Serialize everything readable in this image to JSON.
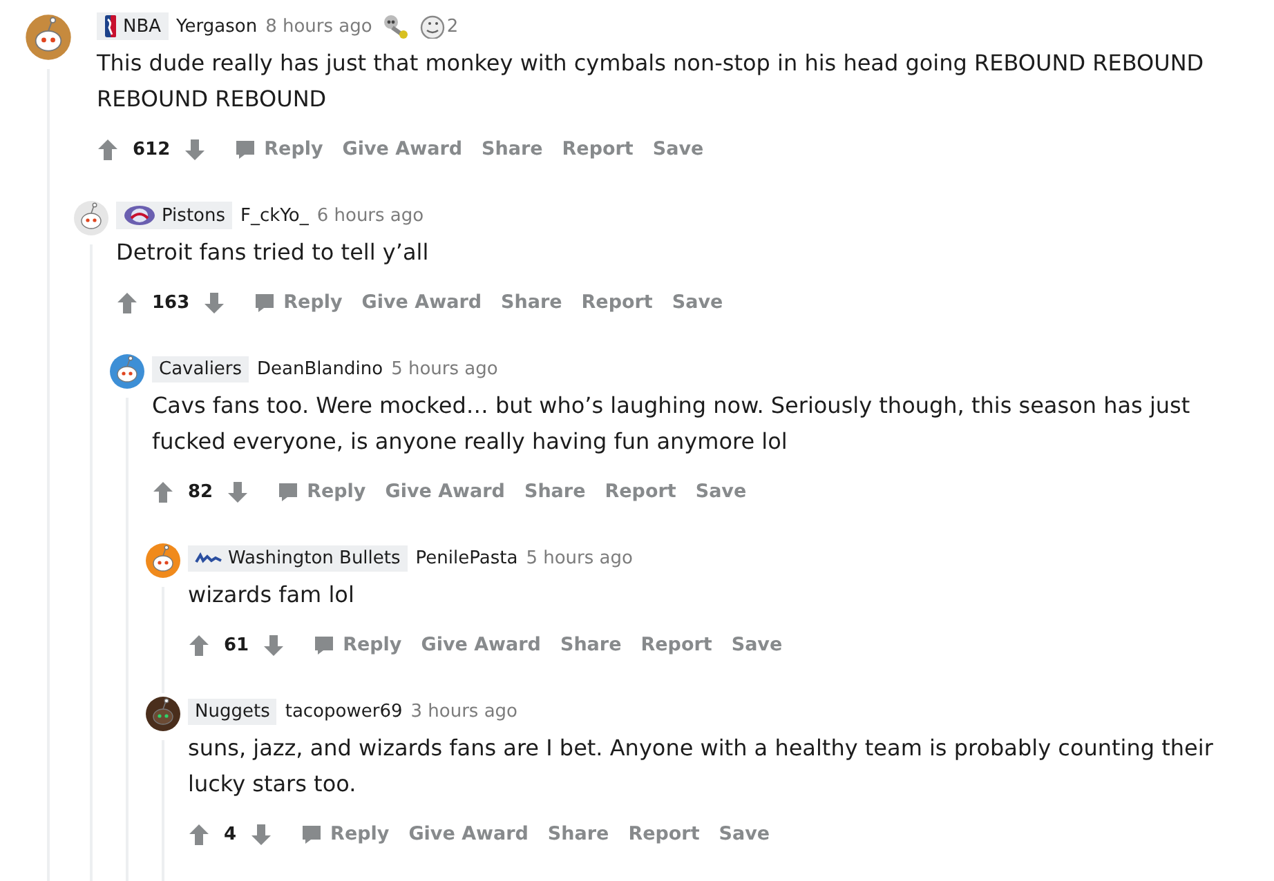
{
  "comments": [
    {
      "flair": {
        "text": "NBA",
        "kind": "shield"
      },
      "author": "Yergason",
      "time": "8 hours ago",
      "awards": [
        {
          "kind": "skull"
        },
        {
          "kind": "face",
          "count": "2"
        }
      ],
      "avatar": {
        "color": "#c68a3e"
      },
      "body": "This dude really has just that monkey with cymbals non-stop in his head going REBOUND REBOUND REBOUND REBOUND",
      "score": "612",
      "actions": [
        "Reply",
        "Give Award",
        "Share",
        "Report",
        "Save"
      ],
      "children": [
        {
          "flair": {
            "text": "Pistons",
            "kind": "ball"
          },
          "author": "F_ckYo_",
          "time": "6 hours ago",
          "avatar": {
            "color": "#e6e6e6"
          },
          "body": "Detroit fans tried to tell y’all",
          "score": "163",
          "actions": [
            "Reply",
            "Give Award",
            "Share",
            "Report",
            "Save"
          ],
          "children": [
            {
              "flair": {
                "text": "Cavaliers"
              },
              "author": "DeanBlandino",
              "time": "5 hours ago",
              "avatar": {
                "color": "#3d8fd6"
              },
              "body": "Cavs fans too. Were mocked… but who’s laughing now. Seriously though, this season has just fucked everyone, is anyone really having fun anymore lol",
              "score": "82",
              "actions": [
                "Reply",
                "Give Award",
                "Share",
                "Report",
                "Save"
              ],
              "children": [
                {
                  "flair": {
                    "text": "Washington Bullets",
                    "kind": "wordmark"
                  },
                  "author": "PenilePasta",
                  "time": "5 hours ago",
                  "avatar": {
                    "color": "#f08a1c"
                  },
                  "body": "wizards fam lol",
                  "score": "61",
                  "actions": [
                    "Reply",
                    "Give Award",
                    "Share",
                    "Report",
                    "Save"
                  ]
                },
                {
                  "flair": {
                    "text": "Nuggets"
                  },
                  "author": "tacopower69",
                  "time": "3 hours ago",
                  "avatar": {
                    "color": "#4a2e1c"
                  },
                  "body": "suns, jazz, and wizards fans are I bet. Anyone with a healthy team is probably counting their lucky stars too.",
                  "score": "4",
                  "actions": [
                    "Reply",
                    "Give Award",
                    "Share",
                    "Report",
                    "Save"
                  ]
                }
              ]
            }
          ]
        }
      ]
    }
  ]
}
